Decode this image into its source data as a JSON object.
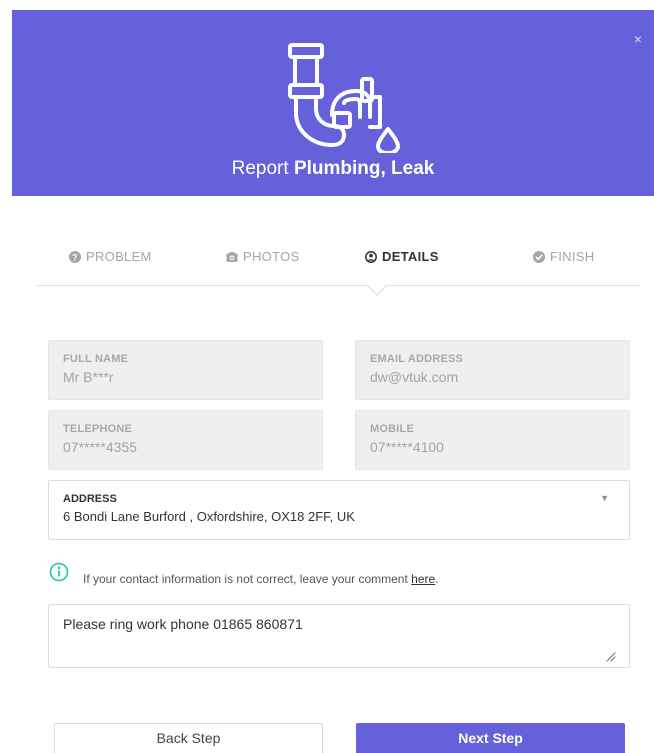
{
  "header": {
    "close_symbol": "×",
    "title_prefix": "Report",
    "title_bold": "Plumbing, Leak",
    "icon": "plumbing-pipe-icon",
    "background": "#6461db"
  },
  "steps": [
    {
      "label": "PROBLEM",
      "icon": "question-circle-icon",
      "active": false
    },
    {
      "label": "PHOTOS",
      "icon": "camera-icon",
      "active": false
    },
    {
      "label": "DETAILS",
      "icon": "user-circle-icon",
      "active": true
    },
    {
      "label": "FINISH",
      "icon": "check-circle-icon",
      "active": false
    }
  ],
  "form": {
    "full_name": {
      "label": "FULL NAME",
      "value": "Mr B***r"
    },
    "email": {
      "label": "EMAIL ADDRESS",
      "value": "dw@vtuk.com"
    },
    "telephone": {
      "label": "TELEPHONE",
      "value": "07*****4355"
    },
    "mobile": {
      "label": "MOBILE",
      "value": "07*****4100"
    },
    "address": {
      "label": "ADDRESS",
      "value": "6 Bondi Lane Burford , Oxfordshire, OX18 2FF, UK",
      "dropdown_symbol": "▼"
    }
  },
  "info": {
    "text": "If your contact information is not correct, leave your comment",
    "link": "here",
    "suffix": ".",
    "icon": "info-circle-icon",
    "icon_color": "#1ec8a5"
  },
  "comment": {
    "value": "Please ring work phone 01865 860871"
  },
  "buttons": {
    "back": "Back Step",
    "next": "Next Step"
  }
}
